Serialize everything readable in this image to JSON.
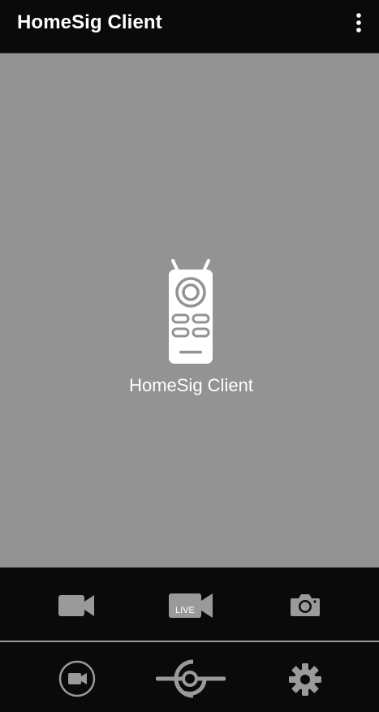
{
  "appbar": {
    "title": "HomeSig Client",
    "overflow_icon": "more-vert-icon"
  },
  "viewer": {
    "placeholder_icon": "remote-control-icon",
    "placeholder_label": "HomeSig Client",
    "background": "#939393"
  },
  "actionbar": {
    "buttons": [
      {
        "icon": "video-record-icon"
      },
      {
        "icon": "video-live-icon",
        "badge": "LIVE"
      },
      {
        "icon": "camera-icon"
      }
    ]
  },
  "bottomnav": {
    "items": [
      {
        "icon": "video-circle-icon"
      },
      {
        "icon": "signal-connect-icon"
      },
      {
        "icon": "settings-gear-icon"
      }
    ]
  },
  "colors": {
    "bar_background": "#0a0a0a",
    "icon_gray": "#9a9a9a",
    "text_white": "#ffffff"
  }
}
